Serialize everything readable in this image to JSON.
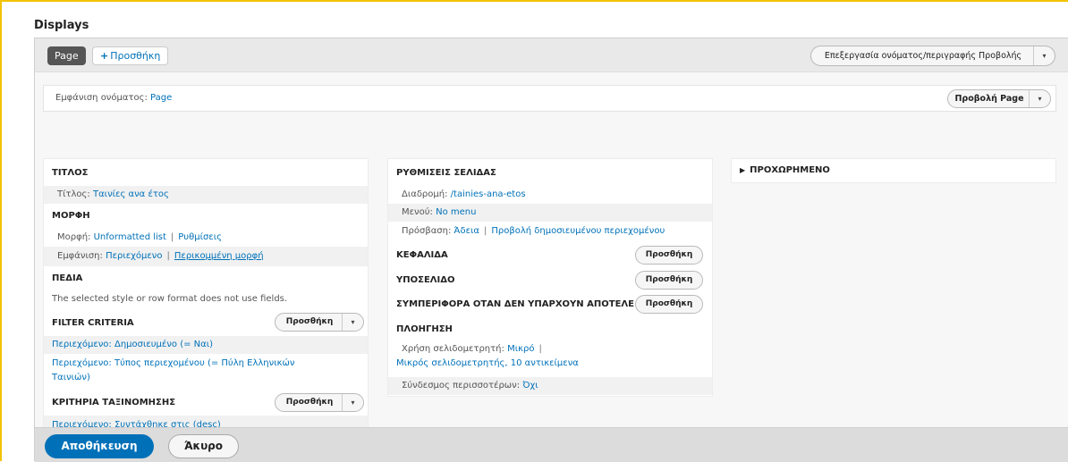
{
  "title": "Displays",
  "tabs": {
    "active": "Page",
    "add": "Προσθήκη",
    "add_icon": "+"
  },
  "edit_button": "Επεξεργασία ονόματος/περιγραφής Προβολής",
  "name_bar": {
    "label": "Εμφάνιση ονόματος:",
    "value": "Page",
    "view_button": "Προβολή Page"
  },
  "caret": "▾",
  "left": {
    "title_head": "ΤΙΤΛΟΣ",
    "title_label": "Τίτλος:",
    "title_value": "Ταινίες ανα έτος",
    "format_head": "ΜΟΡΦΗ",
    "format_label": "Μορφή:",
    "format_value": "Unformatted list",
    "format_settings": "Ρυθμίσεις",
    "show_label": "Εμφάνιση:",
    "show_value": "Περιεχόμενο",
    "show_extra": "Περικομμένη μορφή",
    "fields_head": "ΠΕΔΙΑ",
    "fields_note": "The selected style or row format does not use fields.",
    "filter_head": "FILTER CRITERIA",
    "filter_item1": "Περιεχόμενο: Δημοσιευμένο (= Ναι)",
    "filter_item2_line1": "Περιεχόμενο: Τύπος περιεχομένου (= Πύλη Ελληνικών",
    "filter_item2_line2": "Ταινιών)",
    "sort_head": "ΚΡΙΤΗΡΙΑ ΤΑΞΙΝΟΜΗΣΗΣ",
    "sort_item1": "Περιεχόμενο: Συντάχθηκε στις (desc)",
    "add_label": "Προσθήκη"
  },
  "middle": {
    "page_head": "ΡΥΘΜΙΣΕΙΣ ΣΕΛΙΔΑΣ",
    "path_label": "Διαδρομή:",
    "path_value": "/tainies-ana-etos",
    "menu_label": "Μενού:",
    "menu_value": "No menu",
    "access_label": "Πρόσβαση:",
    "access_value": "Άδεια",
    "access_extra": "Προβολή δημοσιευμένου περιεχομένου",
    "header_head": "ΚΕΦΑΛΙΔΑ",
    "footer_head": "ΥΠΟΣΕΛΙΔΟ",
    "empty_head": "ΣΥΜΠΕΡΙΦΟΡΑ ΟΤΑΝ ΔΕΝ ΥΠΑΡΧΟΥΝ ΑΠΟΤΕΛΕ",
    "pager_head": "ΠΛΟΗΓΗΣΗ",
    "pager_label": "Χρήση σελιδομετρητή:",
    "pager_value": "Μικρό",
    "pager_extra": "Μικρός σελιδομετρητής, 10 αντικείμενα",
    "more_label": "Σύνδεσμος περισσοτέρων:",
    "more_value": "Όχι",
    "add_label": "Προσθήκη"
  },
  "advanced": {
    "label": "ΠΡΟΧΩΡΗΜΕΝΟ",
    "icon": "▶"
  },
  "footer": {
    "save": "Αποθήκευση",
    "cancel": "Άκυρο"
  },
  "colors": {
    "accent": "#0071b8",
    "frame": "#f2c200"
  }
}
